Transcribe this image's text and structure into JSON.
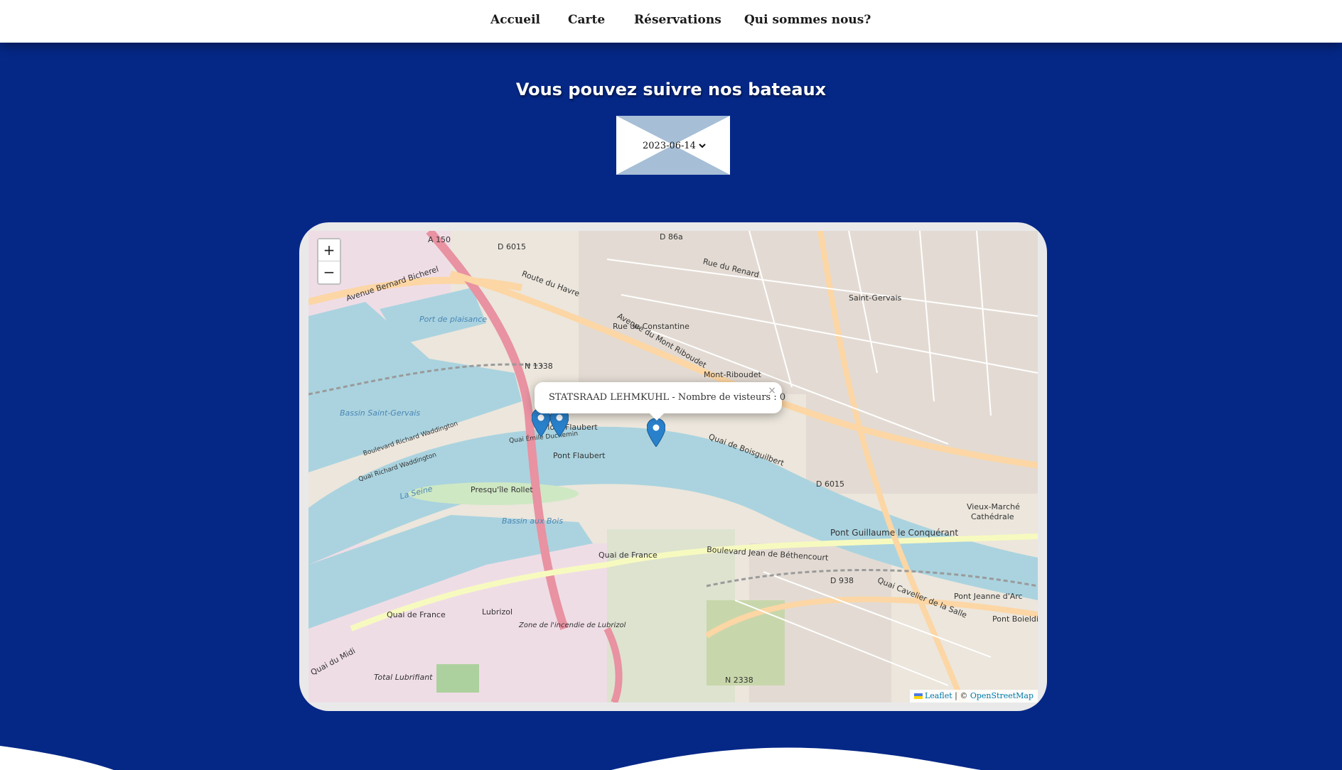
{
  "nav": {
    "items": [
      "Accueil",
      "Carte",
      "Réservations",
      "Qui sommes nous?"
    ]
  },
  "page_title": "Vous pouvez suivre nos bateaux",
  "date_select": {
    "selected": "2023-06-14",
    "options": [
      "2023-06-14"
    ]
  },
  "map": {
    "zoom_in": "+",
    "zoom_out": "−",
    "popup_text": "STATSRAAD LEHMKUHL - Nombre de visteurs : 0",
    "popup_close": "×",
    "attribution_leaflet": "Leaflet",
    "attribution_sep": "| ©",
    "attribution_osm": "OpenStreetMap",
    "labels": {
      "a150": "A 150",
      "d6015": "D 6015",
      "d86a": "D 86a",
      "route_havre": "Route du Havre",
      "av_bernard": "Avenue Bernard Bicherel",
      "port_plaisance": "Port de plaisance",
      "n1338": "N 1338",
      "av_mont_riboudet": "Avenue du Mont Riboudet",
      "mont_riboudet": "Mont-Riboudet",
      "saint_gervais": "Saint-Gervais",
      "bassin_st_gervais": "Bassin Saint-Gervais",
      "mont_flaubert": "Mont Flaubert",
      "quai_emile": "Quai Émile Duchemin",
      "bd_waddington": "Boulevard Richard Waddington",
      "quai_waddington": "Quai Richard Waddington",
      "pont_flaubert": "Pont Flaubert",
      "quai_boisguilbert": "Quai de Boisguilbert",
      "la_seine": "La Seine",
      "presquile": "Presqu'île Rollet",
      "bassin_bois": "Bassin aux Bois",
      "d6015b": "D 6015",
      "vieux_marche": "Vieux-Marché",
      "cathedrale": "Cathédrale",
      "pont_guillaume": "Pont Guillaume le Conquérant",
      "quai_france": "Quai de France",
      "bd_bethencourt": "Boulevard Jean de Béthencourt",
      "d938": "D 938",
      "quai_cavelier": "Quai Cavelier de la Salle",
      "pont_jeanne": "Pont Jeanne d'Arc",
      "pont_boieldieu": "Pont Boieldieu",
      "lubrizol": "Lubrizol",
      "total": "Total Lubrifiant",
      "n2338": "N 2338",
      "quai_midi": "Quai du Midi",
      "zone_incendie": "Zone de l'incendie de Lubrizol",
      "rue_renard": "Rue du Renard",
      "rue_constantine": "Rue de Constantine"
    }
  },
  "colors": {
    "background": "#052887",
    "water": "#aad3df",
    "marker": "#2a81cb"
  }
}
